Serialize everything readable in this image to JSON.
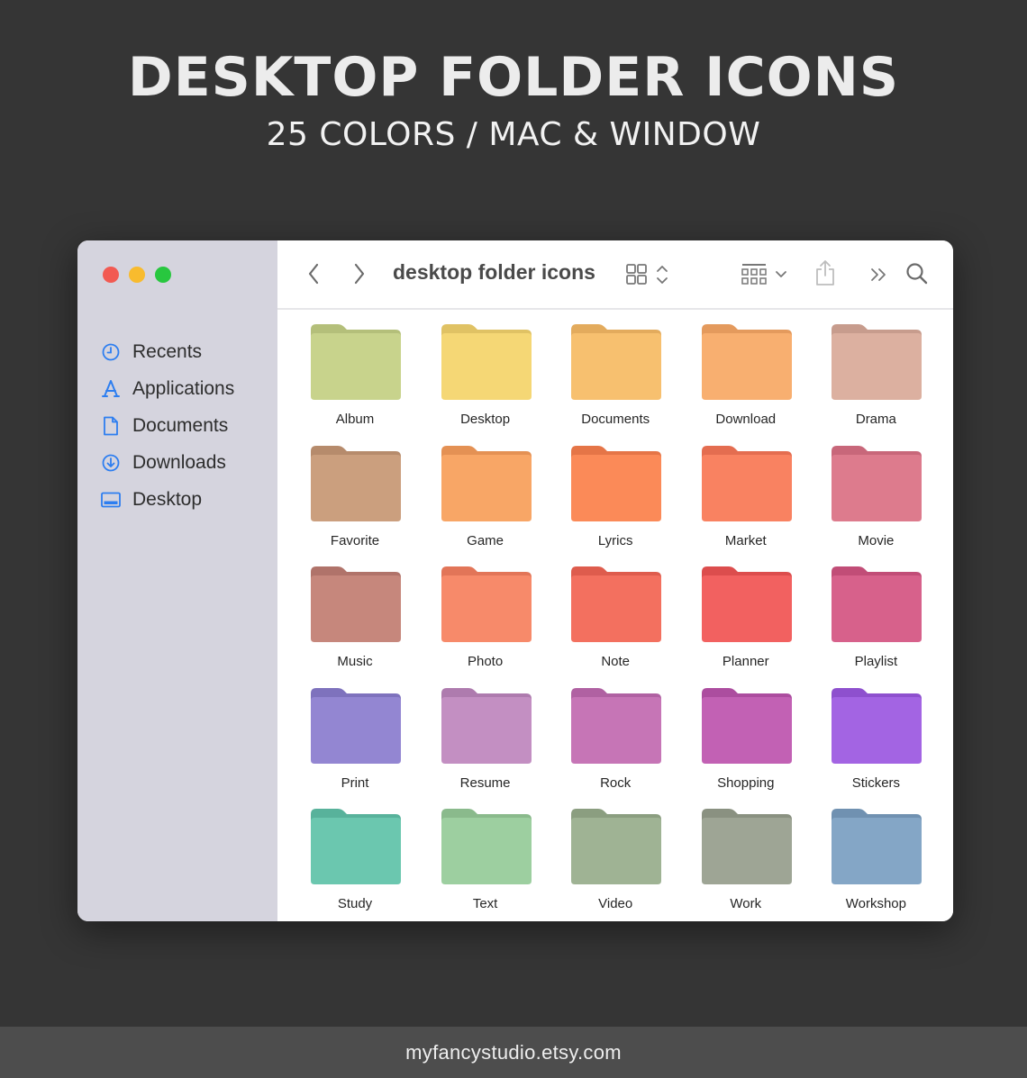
{
  "banner": {
    "title": "DESKTOP FOLDER ICONS",
    "subtitle": "25 COLORS / MAC & WINDOW"
  },
  "window": {
    "title": "desktop folder icons",
    "traffic_lights": [
      "#f25a52",
      "#f8bb2e",
      "#28c73f"
    ],
    "sidebar": {
      "items": [
        {
          "label": "Recents",
          "icon": "clock-icon"
        },
        {
          "label": "Applications",
          "icon": "app-store-icon"
        },
        {
          "label": "Documents",
          "icon": "document-icon"
        },
        {
          "label": "Downloads",
          "icon": "download-icon"
        },
        {
          "label": "Desktop",
          "icon": "desktop-icon"
        }
      ],
      "icon_color": "#2d7ef0"
    },
    "folders": [
      {
        "name": "Album",
        "color": "#c8d38c",
        "tab": "#b4bf7a"
      },
      {
        "name": "Desktop",
        "color": "#f5d775",
        "tab": "#e0c264"
      },
      {
        "name": "Documents",
        "color": "#f7c06f",
        "tab": "#e3ab5d"
      },
      {
        "name": "Download",
        "color": "#f8af70",
        "tab": "#e49a5d"
      },
      {
        "name": "Drama",
        "color": "#dcb0a0",
        "tab": "#c79c8d"
      },
      {
        "name": "Favorite",
        "color": "#cb9f7e",
        "tab": "#b68b6c"
      },
      {
        "name": "Game",
        "color": "#f8a666",
        "tab": "#e49154"
      },
      {
        "name": "Lyrics",
        "color": "#fb8a58",
        "tab": "#e57547"
      },
      {
        "name": "Market",
        "color": "#f98261",
        "tab": "#e46d50"
      },
      {
        "name": "Movie",
        "color": "#dd7b8d",
        "tab": "#c8677a"
      },
      {
        "name": "Music",
        "color": "#c6877c",
        "tab": "#b0736a"
      },
      {
        "name": "Photo",
        "color": "#f78a6a",
        "tab": "#e27558"
      },
      {
        "name": "Note",
        "color": "#f3705f",
        "tab": "#de5c4d"
      },
      {
        "name": "Planner",
        "color": "#f26160",
        "tab": "#dc4d4d"
      },
      {
        "name": "Playlist",
        "color": "#d7618b",
        "tab": "#c14d77"
      },
      {
        "name": "Print",
        "color": "#9386d2",
        "tab": "#7e72bd"
      },
      {
        "name": "Resume",
        "color": "#c38fc2",
        "tab": "#ae7bae"
      },
      {
        "name": "Rock",
        "color": "#c675b6",
        "tab": "#b061a2"
      },
      {
        "name": "Shopping",
        "color": "#c261b4",
        "tab": "#ac4d9f"
      },
      {
        "name": "Stickers",
        "color": "#a364e3",
        "tab": "#8e50ce"
      },
      {
        "name": "Study",
        "color": "#6bc7af",
        "tab": "#58b29b"
      },
      {
        "name": "Text",
        "color": "#9dcfa0",
        "tab": "#8aba8c"
      },
      {
        "name": "Video",
        "color": "#9fb394",
        "tab": "#8b9e80"
      },
      {
        "name": "Work",
        "color": "#9ea595",
        "tab": "#8a9181"
      },
      {
        "name": "Workshop",
        "color": "#84a6c6",
        "tab": "#7091b1"
      }
    ]
  },
  "footer": {
    "text": "myfancystudio.etsy.com"
  }
}
